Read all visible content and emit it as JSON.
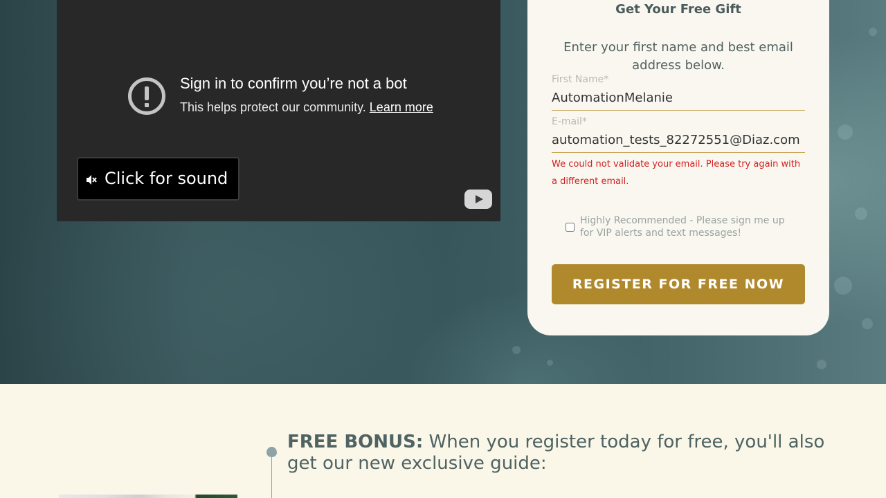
{
  "video": {
    "title": "Sign in to confirm you’re not a bot",
    "subtitle": "This helps protect our community.",
    "link": "Learn more",
    "sound_button": "Click for sound",
    "icons": {
      "alert": "alert-circle-icon",
      "mute": "mute-icon",
      "logo": "youtube-logo-icon"
    }
  },
  "form": {
    "title": "Get Your Free Gift",
    "intro": "Enter your first name and best email address below.",
    "first_name": {
      "label": "First Name*",
      "value": "AutomationMelanie"
    },
    "email": {
      "label": "E-mail*",
      "value": "automation_tests_82272551@Diaz.com"
    },
    "error": "We could not validate your email. Please try again with a different email.",
    "vip_checkbox": {
      "label": "Highly Recommended - Please sign me up for VIP alerts and text messages!",
      "checked": false
    },
    "submit": "REGISTER FOR FREE NOW"
  },
  "bonus": {
    "lead": "FREE BONUS:",
    "text": " When you register today for free, you'll also get our new exclusive guide:"
  },
  "colors": {
    "accent": "#b0892c",
    "error": "#d42020",
    "text_dark": "#4e6362",
    "section_bg": "#faf6e8"
  }
}
